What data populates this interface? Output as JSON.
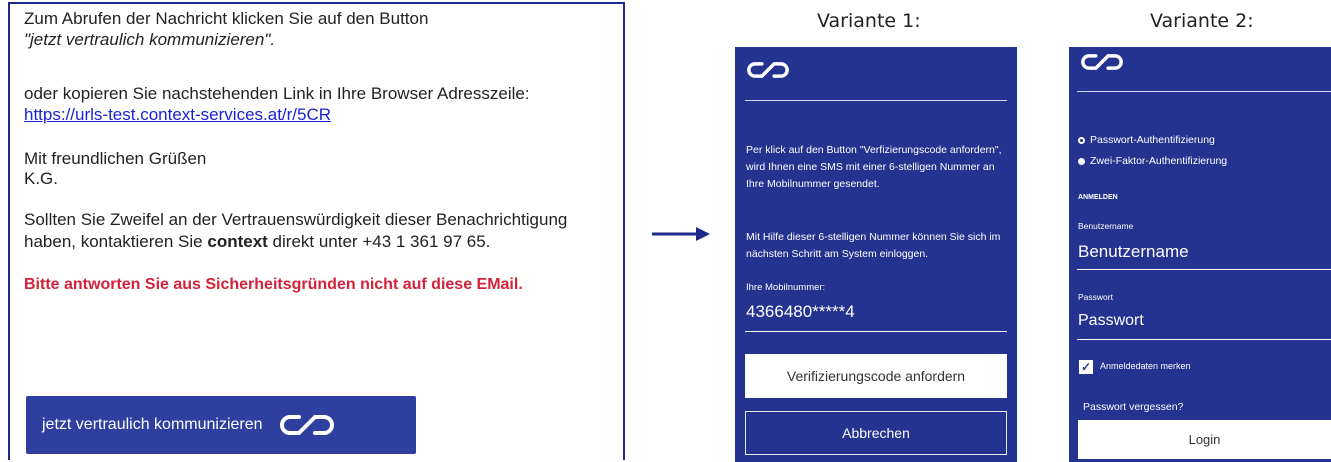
{
  "email": {
    "line1": "Zum Abrufen der Nachricht klicken Sie auf den Button",
    "line2": "\"jetzt vertraulich kommunizieren\".",
    "line3": "oder kopieren Sie nachstehenden Link in Ihre Browser Adresszeile:",
    "link": "https://urls-test.context-services.at/r/5CR",
    "greeting": "Mit freundlichen Grüßen",
    "signature": "K.G.",
    "doubt_line1": "Sollten Sie Zweifel an der Vertrauenswürdigkeit dieser Benachrichtigung",
    "doubt_line2_pre": "haben, kontaktieren Sie ",
    "doubt_brand": "context",
    "doubt_line2_post": " direkt unter +43 1 361 97 65.",
    "warning": "Bitte antworten Sie aus Sicherheitsgründen nicht auf diese EMail.",
    "button_label": "jetzt vertraulich kommunizieren"
  },
  "variante1": {
    "title": "Variante 1:",
    "para1": "Per klick auf den Button \"Verfizierungscode anfordern\", wird Ihnen eine SMS mit einer 6-stelligen Nummer an Ihre Mobilnummer gesendet.",
    "para2": "Mit Hilfe dieser 6-stelligen Nummer können Sie sich im nächsten Schritt am System einloggen.",
    "mobile_label": "Ihre Mobilnummer:",
    "mobile_value": "4366480*****4",
    "request_button": "Verifizierungscode anfordern",
    "cancel_button": "Abbrechen"
  },
  "variante2": {
    "title": "Variante 2:",
    "radio_password": "Passwort-Authentifizierung",
    "radio_2fa": "Zwei-Faktor-Authentifizierung",
    "section_label": "ANMELDEN",
    "username_label": "Benutzername",
    "username_placeholder": "Benutzername",
    "password_label": "Passwort",
    "password_placeholder": "Passwort",
    "remember_label": "Anmeldedaten merken",
    "forgot_link": "Passwort vergessen?",
    "login_button": "Login"
  },
  "colors": {
    "brand_blue": "#23338f",
    "email_button": "#2f3fa0",
    "warning_red": "#d3223a",
    "link_blue": "#1a22d6"
  },
  "icons": [
    "chain-link-logo-icon",
    "arrow-right-icon",
    "checkmark-icon"
  ]
}
